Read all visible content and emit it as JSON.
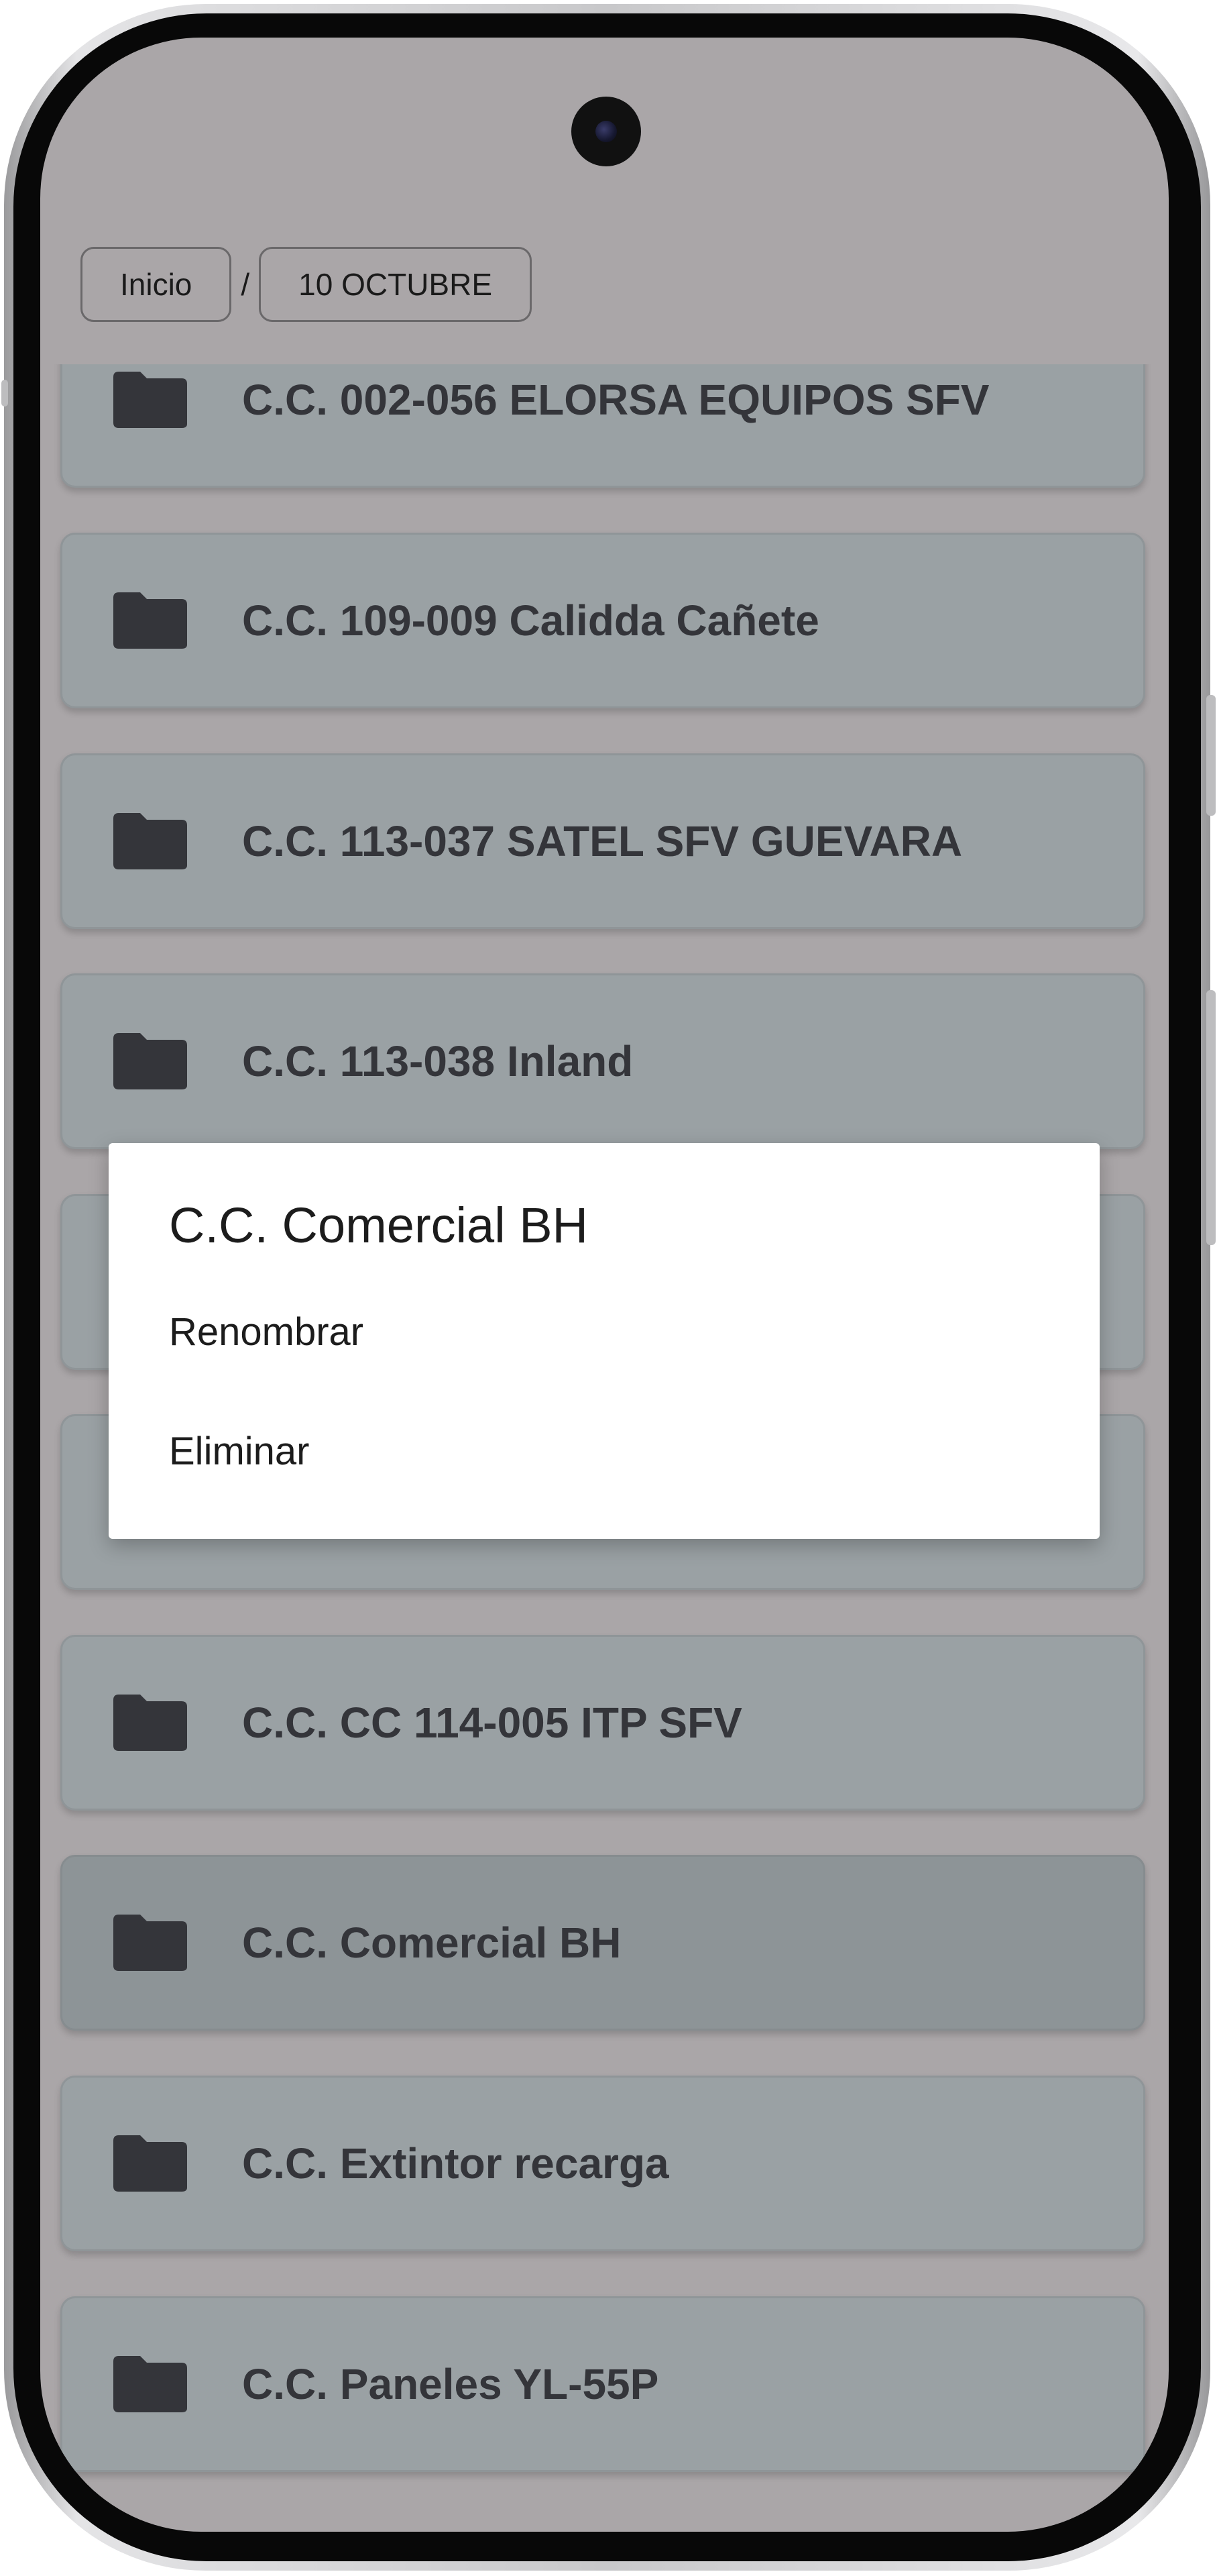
{
  "breadcrumb": {
    "home": "Inicio",
    "separator": "/",
    "current": "10 OCTUBRE"
  },
  "folder_icon": "folder-icon",
  "folders": [
    {
      "label": "C.C. 002-056 ELORSA EQUIPOS SFV"
    },
    {
      "label": "C.C. 109-009 Calidda Cañete"
    },
    {
      "label": "C.C. 113-037 SATEL SFV GUEVARA"
    },
    {
      "label": "C.C. 113-038 Inland"
    },
    {
      "label": ""
    },
    {
      "label": ""
    },
    {
      "label": "C.C. CC 114-005 ITP SFV"
    },
    {
      "label": "C.C. Comercial BH"
    },
    {
      "label": "C.C. Extintor recarga"
    },
    {
      "label": "C.C. Paneles YL-55P"
    }
  ],
  "context_menu": {
    "title": "C.C. Comercial BH",
    "options": [
      {
        "label": "Renombrar"
      },
      {
        "label": "Eliminar"
      }
    ]
  },
  "colors": {
    "screen_background": "#aaa6a8",
    "folder_card": "#9aa1a4",
    "folder_card_selected": "#8d9497",
    "folder_text": "#34353a",
    "dialog_background": "#ffffff"
  }
}
